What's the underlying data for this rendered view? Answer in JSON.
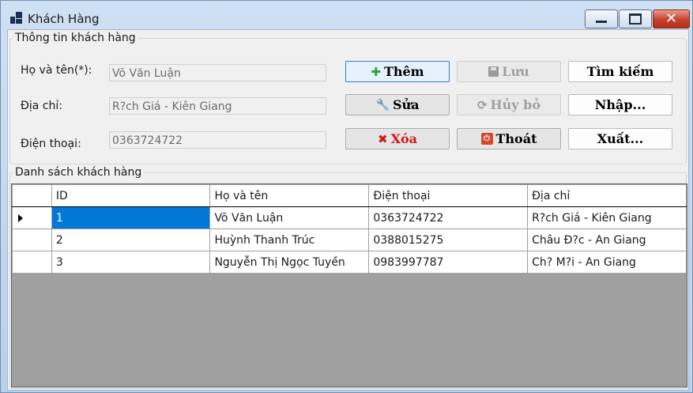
{
  "window": {
    "title": "Khách Hàng",
    "minimize_icon": "minimize-icon",
    "maximize_icon": "maximize-icon",
    "close_glyph": "✕"
  },
  "info_group": {
    "title": "Thông tin khách hàng",
    "fields": [
      {
        "label": "Họ và tên(*):",
        "value": "Võ Văn Luận"
      },
      {
        "label": "Địa chỉ:",
        "value": "R?ch Giá - Kiên Giang"
      },
      {
        "label": "Điện thoại:",
        "value": "0363724722"
      }
    ]
  },
  "buttons": {
    "them": {
      "label": "Thêm",
      "icon": "✚",
      "icon_color": "#2e9e3a"
    },
    "luu": {
      "label": "Lưu",
      "icon": "💾"
    },
    "tim_kiem": {
      "label": "Tìm kiếm"
    },
    "sua": {
      "label": "Sửa",
      "icon": "🔧"
    },
    "huy_bo": {
      "label": "Hủy bỏ",
      "icon": "⟳"
    },
    "nhap": {
      "label": "Nhập..."
    },
    "xoa": {
      "label": "Xóa",
      "icon": "✖",
      "color": "#d01818"
    },
    "thoat": {
      "label": "Thoát",
      "icon": "⏻",
      "icon_color": "#d9482b"
    },
    "xuat": {
      "label": "Xuất..."
    }
  },
  "list_group": {
    "title": "Danh sách khách hàng",
    "columns": [
      "ID",
      "Họ và tên",
      "Điện thoại",
      "Địa chỉ"
    ],
    "rows": [
      [
        "1",
        "Võ Văn Luận",
        "0363724722",
        "R?ch Giá - Kiên Giang"
      ],
      [
        "2",
        "Huỳnh Thanh Trúc",
        "0388015275",
        "Châu Đ?c - An Giang"
      ],
      [
        "3",
        "Nguyễn Thị Ngọc Tuyền",
        "0983997787",
        "Ch? M?i - An Giang"
      ]
    ],
    "selected_row": 0,
    "selection_color": "#0078d7"
  }
}
